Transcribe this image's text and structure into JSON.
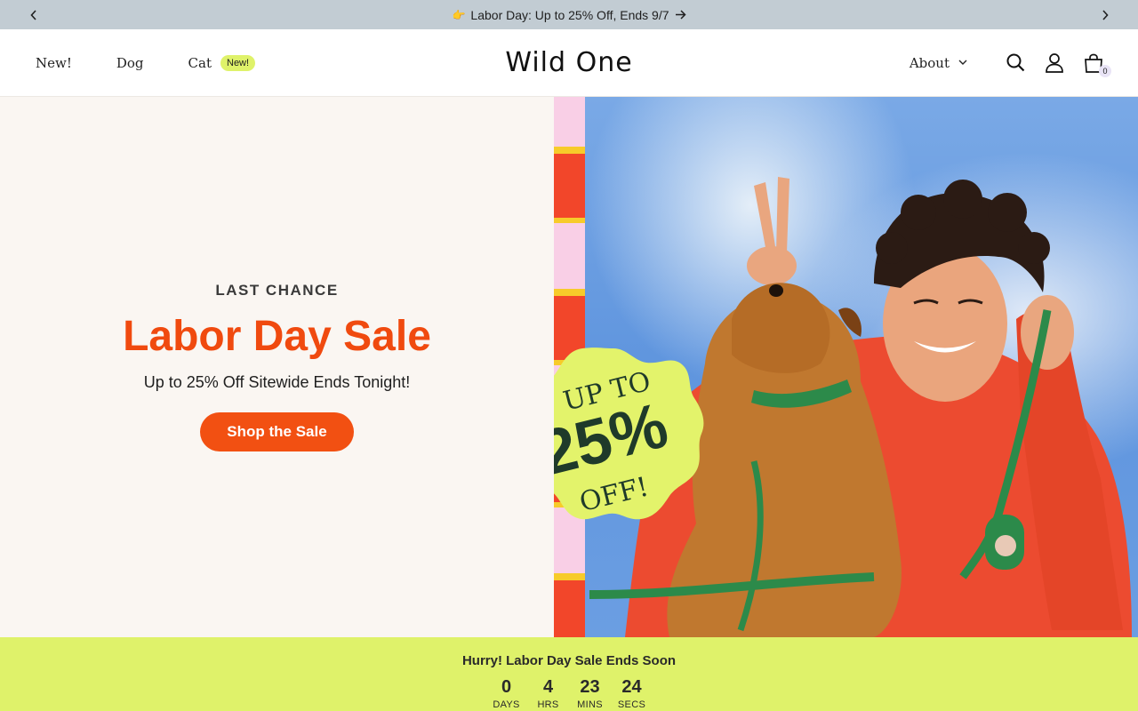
{
  "announcement": {
    "emoji": "👉",
    "text": "Labor Day: Up to 25% Off, Ends 9/7"
  },
  "header": {
    "nav": [
      {
        "label": "New!"
      },
      {
        "label": "Dog"
      },
      {
        "label": "Cat",
        "badge": "New!"
      }
    ],
    "logo": "Wild One",
    "about_label": "About",
    "cart_count": "0"
  },
  "hero": {
    "eyebrow": "LAST CHANCE",
    "title": "Labor Day Sale",
    "subtitle": "Up to 25% Off Sitewide Ends Tonight!",
    "cta_label": "Shop the Sale",
    "burst": {
      "line1": "UP TO",
      "line2": "25%",
      "line3": "OFF!"
    }
  },
  "countdown": {
    "title": "Hurry! Labor Day Sale Ends Soon",
    "units": [
      {
        "value": "0",
        "label": "DAYS"
      },
      {
        "value": "4",
        "label": "HRS"
      },
      {
        "value": "23",
        "label": "MINS"
      },
      {
        "value": "24",
        "label": "SECS"
      }
    ]
  },
  "colors": {
    "accent": "#f25012",
    "announcement_bg": "#c2ccd3",
    "countdown_bg": "#dff26a",
    "hero_left_bg": "#faf6f2"
  }
}
